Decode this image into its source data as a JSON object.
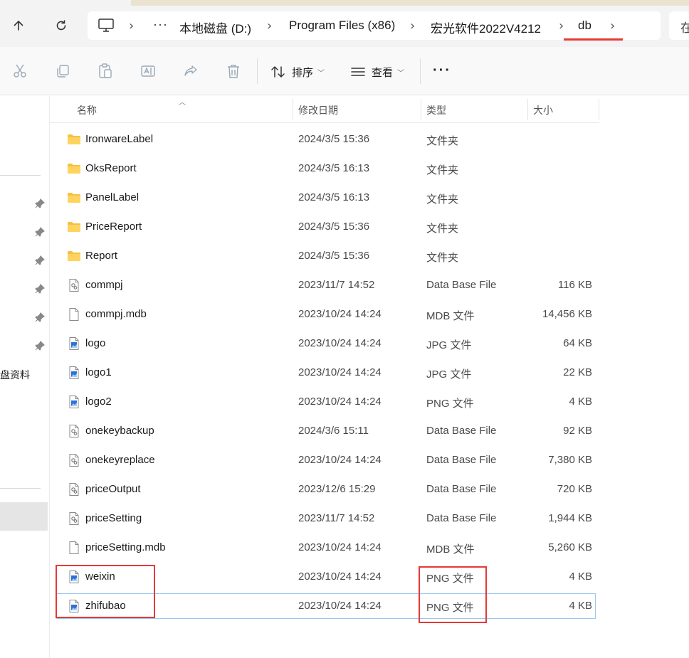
{
  "breadcrumb": {
    "overflow": "···",
    "items": [
      "本地磁盘 (D:)",
      "Program Files (x86)",
      "宏光软件2022V4212",
      "db"
    ],
    "search_hint": "在"
  },
  "toolbar": {
    "sort_label": "排序",
    "view_label": "查看",
    "more_label": "···"
  },
  "nav": {
    "partial_label": "盘资料"
  },
  "columns": {
    "name": "名称",
    "date": "修改日期",
    "type": "类型",
    "size": "大小"
  },
  "files": [
    {
      "name": "IronwareLabel",
      "date": "2024/3/5 15:36",
      "type": "文件夹",
      "size": "",
      "icon": "folder-icon"
    },
    {
      "name": "OksReport",
      "date": "2024/3/5 16:13",
      "type": "文件夹",
      "size": "",
      "icon": "folder-icon"
    },
    {
      "name": "PanelLabel",
      "date": "2024/3/5 16:13",
      "type": "文件夹",
      "size": "",
      "icon": "folder-icon"
    },
    {
      "name": "PriceReport",
      "date": "2024/3/5 15:36",
      "type": "文件夹",
      "size": "",
      "icon": "folder-icon"
    },
    {
      "name": "Report",
      "date": "2024/3/5 15:36",
      "type": "文件夹",
      "size": "",
      "icon": "folder-icon"
    },
    {
      "name": "commpj",
      "date": "2023/11/7 14:52",
      "type": "Data Base File",
      "size": "116 KB",
      "icon": "database-file-icon"
    },
    {
      "name": "commpj.mdb",
      "date": "2023/10/24 14:24",
      "type": "MDB 文件",
      "size": "14,456 KB",
      "icon": "blank-file-icon"
    },
    {
      "name": "logo",
      "date": "2023/10/24 14:24",
      "type": "JPG 文件",
      "size": "64 KB",
      "icon": "image-file-icon"
    },
    {
      "name": "logo1",
      "date": "2023/10/24 14:24",
      "type": "JPG 文件",
      "size": "22 KB",
      "icon": "image-file-icon"
    },
    {
      "name": "logo2",
      "date": "2023/10/24 14:24",
      "type": "PNG 文件",
      "size": "4 KB",
      "icon": "image-file-icon"
    },
    {
      "name": "onekeybackup",
      "date": "2024/3/6 15:11",
      "type": "Data Base File",
      "size": "92 KB",
      "icon": "database-file-icon"
    },
    {
      "name": "onekeyreplace",
      "date": "2023/10/24 14:24",
      "type": "Data Base File",
      "size": "7,380 KB",
      "icon": "database-file-icon"
    },
    {
      "name": "priceOutput",
      "date": "2023/12/6 15:29",
      "type": "Data Base File",
      "size": "720 KB",
      "icon": "database-file-icon"
    },
    {
      "name": "priceSetting",
      "date": "2023/11/7 14:52",
      "type": "Data Base File",
      "size": "1,944 KB",
      "icon": "database-file-icon"
    },
    {
      "name": "priceSetting.mdb",
      "date": "2023/10/24 14:24",
      "type": "MDB 文件",
      "size": "5,260 KB",
      "icon": "blank-file-icon"
    },
    {
      "name": "weixin",
      "date": "2023/10/24 14:24",
      "type": "PNG 文件",
      "size": "4 KB",
      "icon": "image-file-icon"
    },
    {
      "name": "zhifubao",
      "date": "2023/10/24 14:24",
      "type": "PNG 文件",
      "size": "4 KB",
      "icon": "image-file-icon",
      "focused": true
    }
  ],
  "colors": {
    "highlight": "#e53935",
    "folder": "#f5c041",
    "image_accent": "#2f6fd6"
  }
}
